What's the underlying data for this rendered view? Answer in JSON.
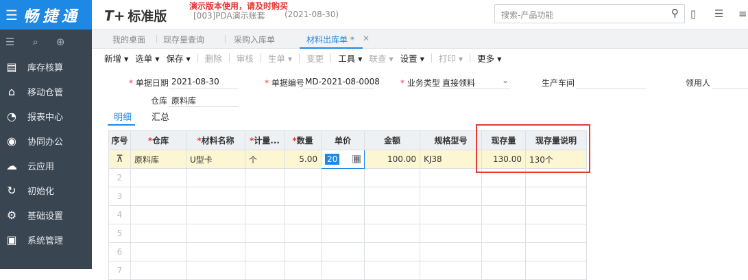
{
  "sidebar": {
    "logo_text": "畅捷通",
    "items": [
      {
        "label": "库存核算",
        "icon": "warehouse-icon"
      },
      {
        "label": "移动仓管",
        "icon": "mobile-warehouse-icon"
      },
      {
        "label": "报表中心",
        "icon": "report-icon"
      },
      {
        "label": "协同办公",
        "icon": "collab-icon"
      },
      {
        "label": "云应用",
        "icon": "cloud-icon"
      },
      {
        "label": "初始化",
        "icon": "init-icon"
      },
      {
        "label": "基础设置",
        "icon": "settings-icon"
      },
      {
        "label": "系统管理",
        "icon": "system-icon"
      }
    ]
  },
  "header": {
    "brand_mark": "T+",
    "brand_name": "标准版",
    "demo_warning": "演示版本使用，请及时购买",
    "account": "[003]PDA演示账套",
    "account_date": "(2021-08-30)",
    "search_placeholder": "搜索-产品功能"
  },
  "tabs": [
    {
      "label": "我的桌面"
    },
    {
      "label": "现存量查询"
    },
    {
      "label": "采购入库单"
    },
    {
      "label": "材料出库单 *"
    }
  ],
  "toolbar": {
    "new": "新增",
    "select": "选单",
    "save": "保存",
    "delete": "删除",
    "audit": "审核",
    "generate": "生单",
    "change": "变更",
    "tools": "工具",
    "query": "联查",
    "settings": "设置",
    "print": "打印",
    "more": "更多"
  },
  "form": {
    "date_label": "单据日期",
    "date_value": "2021-08-30",
    "doc_no_label": "单据编号",
    "doc_no_value": "MD-2021-08-0008",
    "biz_type_label": "业务类型",
    "biz_type_value": "直接领料",
    "workshop_label": "生产车间",
    "receiver_label": "领用人",
    "warehouse_label": "仓库",
    "warehouse_value": "原料库"
  },
  "subtabs": {
    "detail": "明细",
    "summary": "汇总"
  },
  "grid": {
    "headers": [
      "序号",
      "仓库",
      "材料名称",
      "计量...",
      "数量",
      "单价",
      "金额",
      "规格型号",
      "现存量",
      "现存量说明"
    ],
    "required": [
      "仓库",
      "材料名称",
      "计量...",
      "数量"
    ],
    "row1": {
      "warehouse": "原料库",
      "material": "U型卡",
      "unit": "个",
      "qty": "5.00",
      "price": "20",
      "amount": "100.00",
      "spec": "KJ38",
      "stock": "130.00",
      "stock_desc": "130个"
    },
    "row_numbers": [
      "2",
      "3",
      "4",
      "5",
      "6",
      "7"
    ]
  },
  "colors": {
    "accent": "#1e88e5",
    "sidebar_bg": "#3a4552",
    "highlight_box": "#e53935",
    "selected_row": "#fdf6d3"
  }
}
